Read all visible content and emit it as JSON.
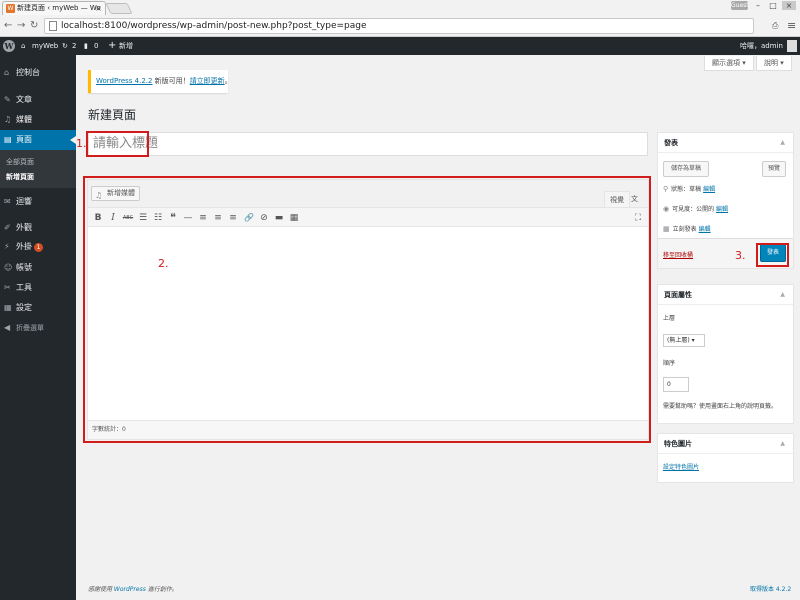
{
  "browser": {
    "tab_title": "新建頁面 ‹ myWeb — Wo",
    "tab_close": "×",
    "guest_label": "Guest",
    "url": "localhost:8100/wordpress/wp-admin/post-new.php?post_type=page",
    "min": "–",
    "max": "□",
    "close": "×"
  },
  "adminbar": {
    "site_name": "myWeb",
    "updates": "2",
    "comments": "0",
    "new": "新增",
    "greeting": "哈囉，admin"
  },
  "sidebar": {
    "items": [
      {
        "label": "控制台",
        "icon": "dashboard-icon",
        "glyph": "⌂"
      },
      {
        "label": "文章",
        "icon": "pin-icon",
        "glyph": "✎"
      },
      {
        "label": "媒體",
        "icon": "media-icon",
        "glyph": "♫"
      },
      {
        "label": "頁面",
        "icon": "pages-icon",
        "glyph": "▤"
      },
      {
        "label": "迴響",
        "icon": "comments-icon",
        "glyph": "✉"
      },
      {
        "label": "外觀",
        "icon": "appearance-icon",
        "glyph": "✐"
      },
      {
        "label": "外掛",
        "icon": "plugins-icon",
        "glyph": "⚡",
        "badge": "1"
      },
      {
        "label": "帳號",
        "icon": "users-icon",
        "glyph": "☺"
      },
      {
        "label": "工具",
        "icon": "tools-icon",
        "glyph": "✂"
      },
      {
        "label": "設定",
        "icon": "settings-icon",
        "glyph": "▦"
      },
      {
        "label": "折疊選單",
        "icon": "collapse-icon",
        "glyph": "◀"
      }
    ],
    "sub": [
      "全部頁面",
      "新增頁面"
    ]
  },
  "screen_options": "顯示選項 ▾",
  "help": "說明 ▾",
  "notice": {
    "version_link": "WordPress 4.2.2",
    "text": " 新版可用！",
    "update_link": "請立即更新",
    "end": "。"
  },
  "page_title": "新建頁面",
  "title_placeholder": "請輸入標題",
  "annotations": {
    "one": "1.",
    "two": "2.",
    "three": "3."
  },
  "editor": {
    "add_media": "新增媒體",
    "tab_visual": "視覺",
    "tab_text": "文字",
    "word_count": "字數統計：0",
    "toolbar": [
      "B",
      "I",
      "ABC",
      "☰",
      "☷",
      "❝",
      "—",
      "≡",
      "≡",
      "≡",
      "🔗",
      "⊘",
      "▬",
      "▦"
    ],
    "fullscreen": "⛶"
  },
  "publish_box": {
    "title": "發表",
    "toggle": "▲",
    "save_draft": "儲存為草稿",
    "preview": "預覽",
    "status_label": "狀態：草稿",
    "status_edit": "編輯",
    "visibility_label": "可見度：公開的",
    "visibility_edit": "編輯",
    "publish_label": "立刻發表",
    "publish_edit": "編輯",
    "trash": "移至回收桶",
    "publish_button": "發表"
  },
  "attributes_box": {
    "title": "頁面屬性",
    "toggle": "▲",
    "parent_label": "上層",
    "parent_value": "(無上層) ▾",
    "order_label": "順序",
    "order_value": "0",
    "help_text": "需要幫助嗎？使用畫面右上角的說明頁籤。"
  },
  "featured_box": {
    "title": "特色圖片",
    "toggle": "▲",
    "link": "設定特色圖片"
  },
  "footer": {
    "left_prefix": "感謝使用 ",
    "left_link": "WordPress",
    "left_suffix": " 進行創作。",
    "right": "取得版本 4.2.2"
  }
}
